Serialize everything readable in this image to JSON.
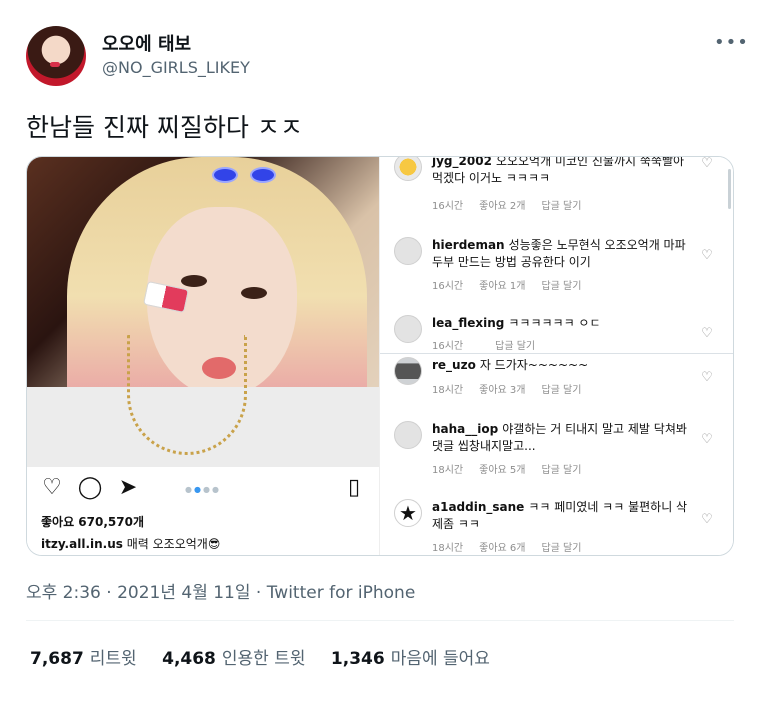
{
  "tweet": {
    "display_name": "오오에 태보",
    "handle": "@NO_GIRLS_LIKEY",
    "text": "한남들 진짜 찌질하다 ㅈㅈ",
    "more_icon": "more-dots-icon",
    "timestamp": "오후 2:36 · 2021년 4월 11일 · ",
    "source": "Twitter for iPhone",
    "stats": [
      {
        "count": "7,687",
        "label": "리트윗"
      },
      {
        "count": "4,468",
        "label": "인용한 트윗"
      },
      {
        "count": "1,346",
        "label": "마음에 들어요"
      }
    ]
  },
  "instagram_post": {
    "likes": "좋아요 670,570개",
    "caption_user": "itzy.all.in.us",
    "caption_text": "매력 오조오억개😎",
    "icons": [
      "heart-icon",
      "comment-icon",
      "share-icon",
      "bookmark-icon"
    ]
  },
  "comments": [
    {
      "user": "jyg_2002",
      "text": "오오오억개 미코인 진물까지 쭉쭉빨아먹겠다 이거노 ㅋㅋㅋㅋ",
      "time": "16시간",
      "likes": "좋아요 2개",
      "reply": "답글 달기"
    },
    {
      "user": "hierdeman",
      "text": "성능좋은 노무현식 오조오억개 마파두부 만드는 방법 공유한다 이기",
      "time": "16시간",
      "likes": "좋아요 1개",
      "reply": "답글 달기"
    },
    {
      "user": "lea_flexing",
      "text": "ㅋㅋㅋㅋㅋㅋ ㅇㄷ",
      "time": "16시간",
      "likes": "",
      "reply": "답글 달기"
    },
    {
      "user": "re_uzo",
      "text": "자 드가자~~~~~~",
      "time": "18시간",
      "likes": "좋아요 3개",
      "reply": "답글 달기"
    },
    {
      "user": "haha__iop",
      "text": "야갤하는 거 티내지 말고 제발 닥쳐봐 댓글 씹창내지말고...",
      "time": "18시간",
      "likes": "좋아요 5개",
      "reply": "답글 달기"
    },
    {
      "user": "a1addin_sane",
      "text": "ㅋㅋ 페미였네 ㅋㅋ 불편하니 삭제좀 ㅋㅋ",
      "time": "18시간",
      "likes": "좋아요 6개",
      "reply": "답글 달기"
    }
  ]
}
